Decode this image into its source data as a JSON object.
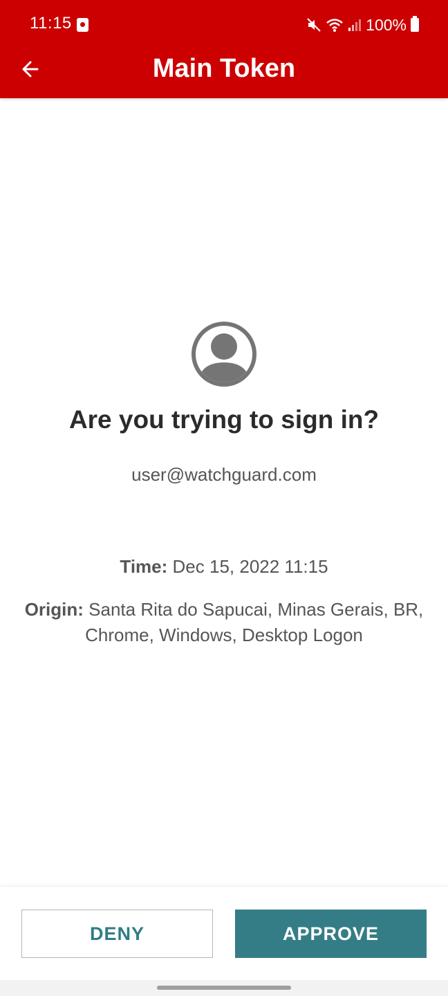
{
  "status_bar": {
    "time": "11:15",
    "battery": "100%",
    "icons": [
      "notification-icon",
      "mute-icon",
      "wifi-icon",
      "signal-icon",
      "battery-icon"
    ]
  },
  "app_bar": {
    "title": "Main Token",
    "back_icon": "arrow-left-icon"
  },
  "prompt": {
    "avatar_icon": "user-avatar-icon",
    "title": "Are you trying to sign in?",
    "email": "user@watchguard.com",
    "time_label": "Time:",
    "time_value": "Dec 15, 2022 11:15",
    "origin_label": "Origin:",
    "origin_value": "Santa Rita do Sapucai, Minas Gerais, BR, Chrome, Windows, Desktop Logon"
  },
  "actions": {
    "deny_label": "DENY",
    "approve_label": "APPROVE"
  },
  "colors": {
    "brand_red": "#cc0000",
    "accent_teal": "#357d86",
    "text_dark": "#2b2b2b",
    "text_gray": "#555555"
  }
}
